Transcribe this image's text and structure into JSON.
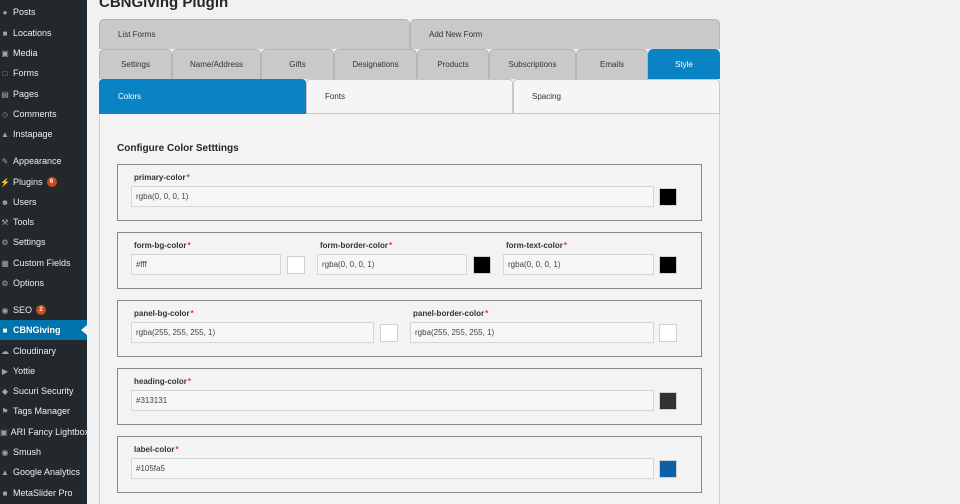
{
  "sidebar": {
    "items": [
      {
        "label": "Posts",
        "icon": "pin-icon"
      },
      {
        "label": "Locations",
        "icon": "location-icon"
      },
      {
        "label": "Media",
        "icon": "media-icon"
      },
      {
        "label": "Forms",
        "icon": "forms-icon"
      },
      {
        "label": "Pages",
        "icon": "pages-icon"
      },
      {
        "label": "Comments",
        "icon": "comments-icon"
      },
      {
        "label": "Instapage",
        "icon": "instapage-icon"
      },
      {
        "label": "Appearance",
        "icon": "appearance-icon"
      },
      {
        "label": "Plugins",
        "icon": "plugins-icon",
        "badge": "6"
      },
      {
        "label": "Users",
        "icon": "users-icon"
      },
      {
        "label": "Tools",
        "icon": "tools-icon"
      },
      {
        "label": "Settings",
        "icon": "settings-icon"
      },
      {
        "label": "Custom Fields",
        "icon": "custom-fields-icon"
      },
      {
        "label": "Options",
        "icon": "options-icon"
      },
      {
        "label": "SEO",
        "icon": "seo-icon",
        "badge": "2"
      },
      {
        "label": "CBNGiving",
        "icon": "cbngiving-icon"
      },
      {
        "label": "Cloudinary",
        "icon": "cloudinary-icon"
      },
      {
        "label": "Yottie",
        "icon": "yottie-icon"
      },
      {
        "label": "Sucuri Security",
        "icon": "sucuri-icon"
      },
      {
        "label": "Tags Manager",
        "icon": "tags-icon"
      },
      {
        "label": "ARI Fancy Lightbox",
        "icon": "lightbox-icon"
      },
      {
        "label": "Smush",
        "icon": "smush-icon"
      },
      {
        "label": "Google Analytics",
        "icon": "analytics-icon"
      },
      {
        "label": "MetaSlider Pro",
        "icon": "metaslider-icon"
      }
    ]
  },
  "page": {
    "title": "CBNGiving Plugin"
  },
  "tabs_row1": [
    "List Forms",
    "Add New Form"
  ],
  "tabs_row2": [
    "Settings",
    "Name/Address",
    "Gifts",
    "Designations",
    "Products",
    "Subscriptions",
    "Emails",
    "Style"
  ],
  "subtabs": [
    "Colors",
    "Fonts",
    "Spacing"
  ],
  "section": {
    "title": "Configure Color Setttings"
  },
  "fields": {
    "primary_color": {
      "label": "primary-color",
      "value": "rgba(0, 0, 0, 1)"
    },
    "form_bg_color": {
      "label": "form-bg-color",
      "value": "#fff"
    },
    "form_border_color": {
      "label": "form-border-color",
      "value": "rgba(0, 0, 0, 1)"
    },
    "form_text_color": {
      "label": "form-text-color",
      "value": "rgba(0, 0, 0, 1)"
    },
    "panel_bg_color": {
      "label": "panel-bg-color",
      "value": "rgba(255, 255, 255, 1)"
    },
    "panel_border_color": {
      "label": "panel-border-color",
      "value": "rgba(255, 255, 255, 1)"
    },
    "heading_color": {
      "label": "heading-color",
      "value": "#313131"
    },
    "label_color": {
      "label": "label-color",
      "value": "#105fa5"
    }
  },
  "required_mark": "*",
  "swatch_colors": {
    "primary_color": "#000000",
    "form_bg_color": "#ffffff",
    "form_border_color": "#000000",
    "form_text_color": "#000000",
    "panel_bg_color": "#ffffff",
    "panel_border_color": "#ffffff",
    "heading_color": "#313131",
    "label_color": "#105fa5"
  },
  "colors": {
    "sidebar_bg": "#23282d",
    "active_menu": "#0073aa",
    "active_tab": "#0a83c4",
    "badge": "#ca4a1f"
  }
}
